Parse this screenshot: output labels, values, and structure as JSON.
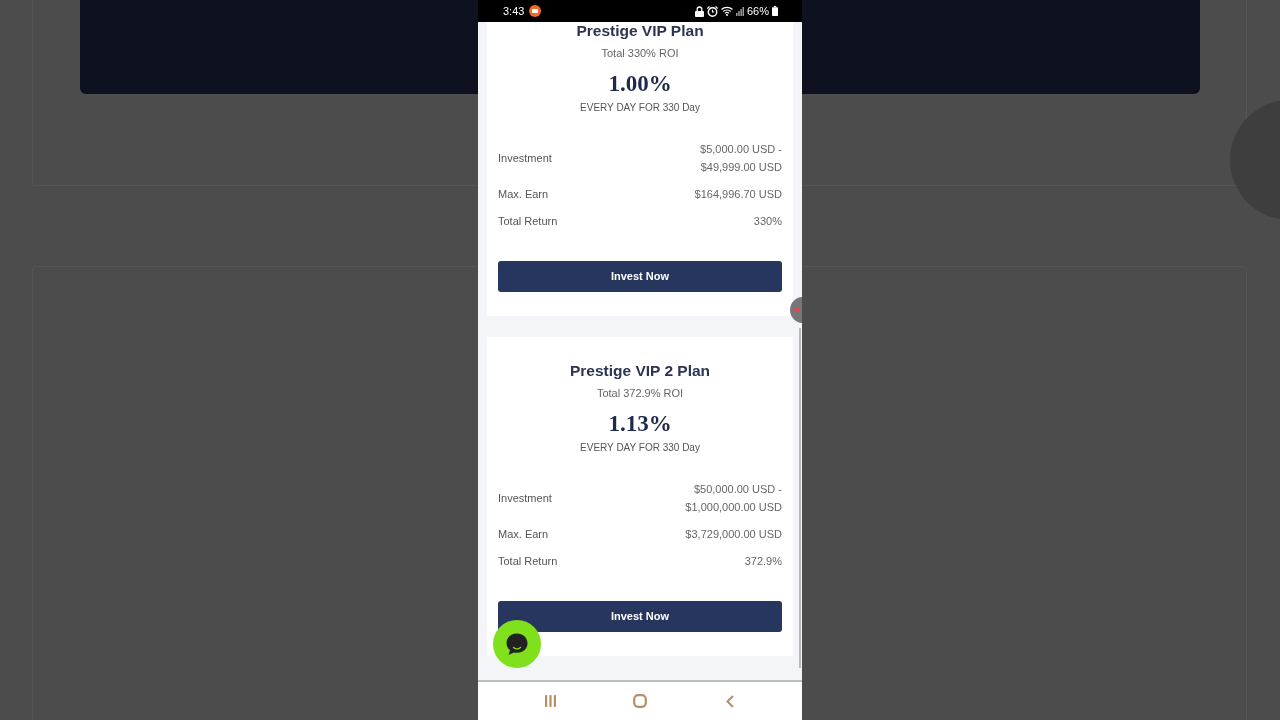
{
  "status_bar": {
    "time": "3:43",
    "battery": "66%"
  },
  "plans": [
    {
      "title": "Prestige VIP Plan",
      "roi": "Total 330% ROI",
      "rate": "1.00%",
      "period": "EVERY DAY FOR 330 Day",
      "details": [
        {
          "label": "Investment",
          "value": "$5,000.00 USD - $49,999.00 USD"
        },
        {
          "label": "Max. Earn",
          "value": "$164,996.70 USD"
        },
        {
          "label": "Total Return",
          "value": "330%"
        }
      ],
      "button": "Invest Now"
    },
    {
      "title": "Prestige VIP 2 Plan",
      "roi": "Total 372.9% ROI",
      "rate": "1.13%",
      "period": "EVERY DAY FOR 330 Day",
      "details": [
        {
          "label": "Investment",
          "value": "$50,000.00 USD - $1,000,000.00 USD"
        },
        {
          "label": "Max. Earn",
          "value": "$3,729,000.00 USD"
        },
        {
          "label": "Total Return",
          "value": "372.9%"
        }
      ],
      "button": "Invest Now"
    }
  ]
}
